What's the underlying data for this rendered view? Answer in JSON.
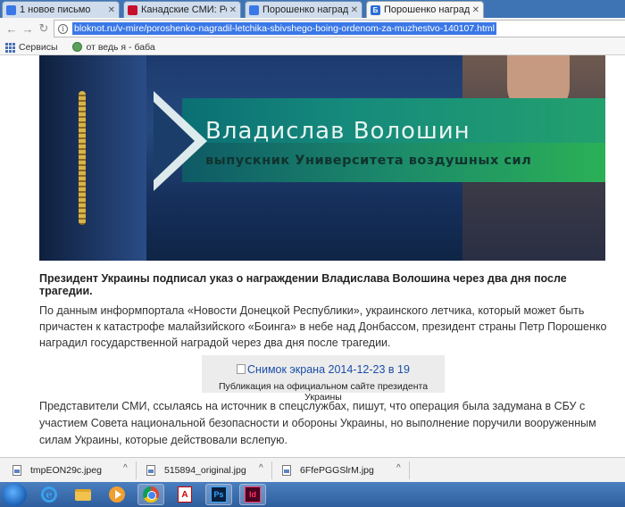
{
  "tabs": [
    {
      "label": "1 новое письмо",
      "favicon_color": "#3b78e7",
      "active": false
    },
    {
      "label": "Канадские СМИ: Россия",
      "favicon_color": "#c8102e",
      "active": false
    },
    {
      "label": "Порошенко наградил Во",
      "favicon_color": "#3b78e7",
      "active": false
    },
    {
      "label": "Порошенко наградил с",
      "favicon_color": "#2a6fd6",
      "favicon_glyph": "Б",
      "active": true
    }
  ],
  "address_bar": {
    "url": "bloknot.ru/v-mire/poroshenko-nagradil-letchika-sbivshego-boing-ordenom-za-muzhestvo-140107.html"
  },
  "bookmarks": [
    {
      "label": "Сервисы",
      "icon": "apps-grid-icon"
    },
    {
      "label": "от ведь я - баба",
      "icon": "globe-icon"
    }
  ],
  "article": {
    "hero": {
      "name": "Владислав Волошин",
      "subtitle": "выпускник Университета воздушных сил"
    },
    "lead": "Президент Украины подписал указ о награждении Владислава Волошина через два дня после трагедии.",
    "paragraph1": "По данным информпортала «Новости Донецкой Республики», украинского летчика, который может быть причастен к катастрофе малайзийского «Боинга» в небе над Донбассом, президент страны Петр Порошенко наградил государственной наградой через два дня после трагедии.",
    "figure": {
      "alt": "Снимок экрана 2014-12-23 в 19",
      "caption": "Публикация на официальном сайте президента Украины"
    },
    "paragraph2": "Представители СМИ, ссылаясь на источник в спецслужбах, пишут, что операция была задумана в СБУ с участием Совета национальной безопасности и обороны Украины, но выполнение поручили вооруженным силам Украины, которые действовали вслепую."
  },
  "downloads": [
    {
      "filename": "tmpEON29c.jpeg"
    },
    {
      "filename": "515894_original.jpg"
    },
    {
      "filename": "6FfePGGSlrM.jpg"
    }
  ],
  "taskbar": {
    "photoshop_label": "Ps",
    "indesign_label": "Id",
    "pdf_label": "A"
  },
  "colors": {
    "tabstrip": "#3e74b4",
    "url_highlight": "#3b78e7",
    "hero_band": "#168b7c"
  }
}
